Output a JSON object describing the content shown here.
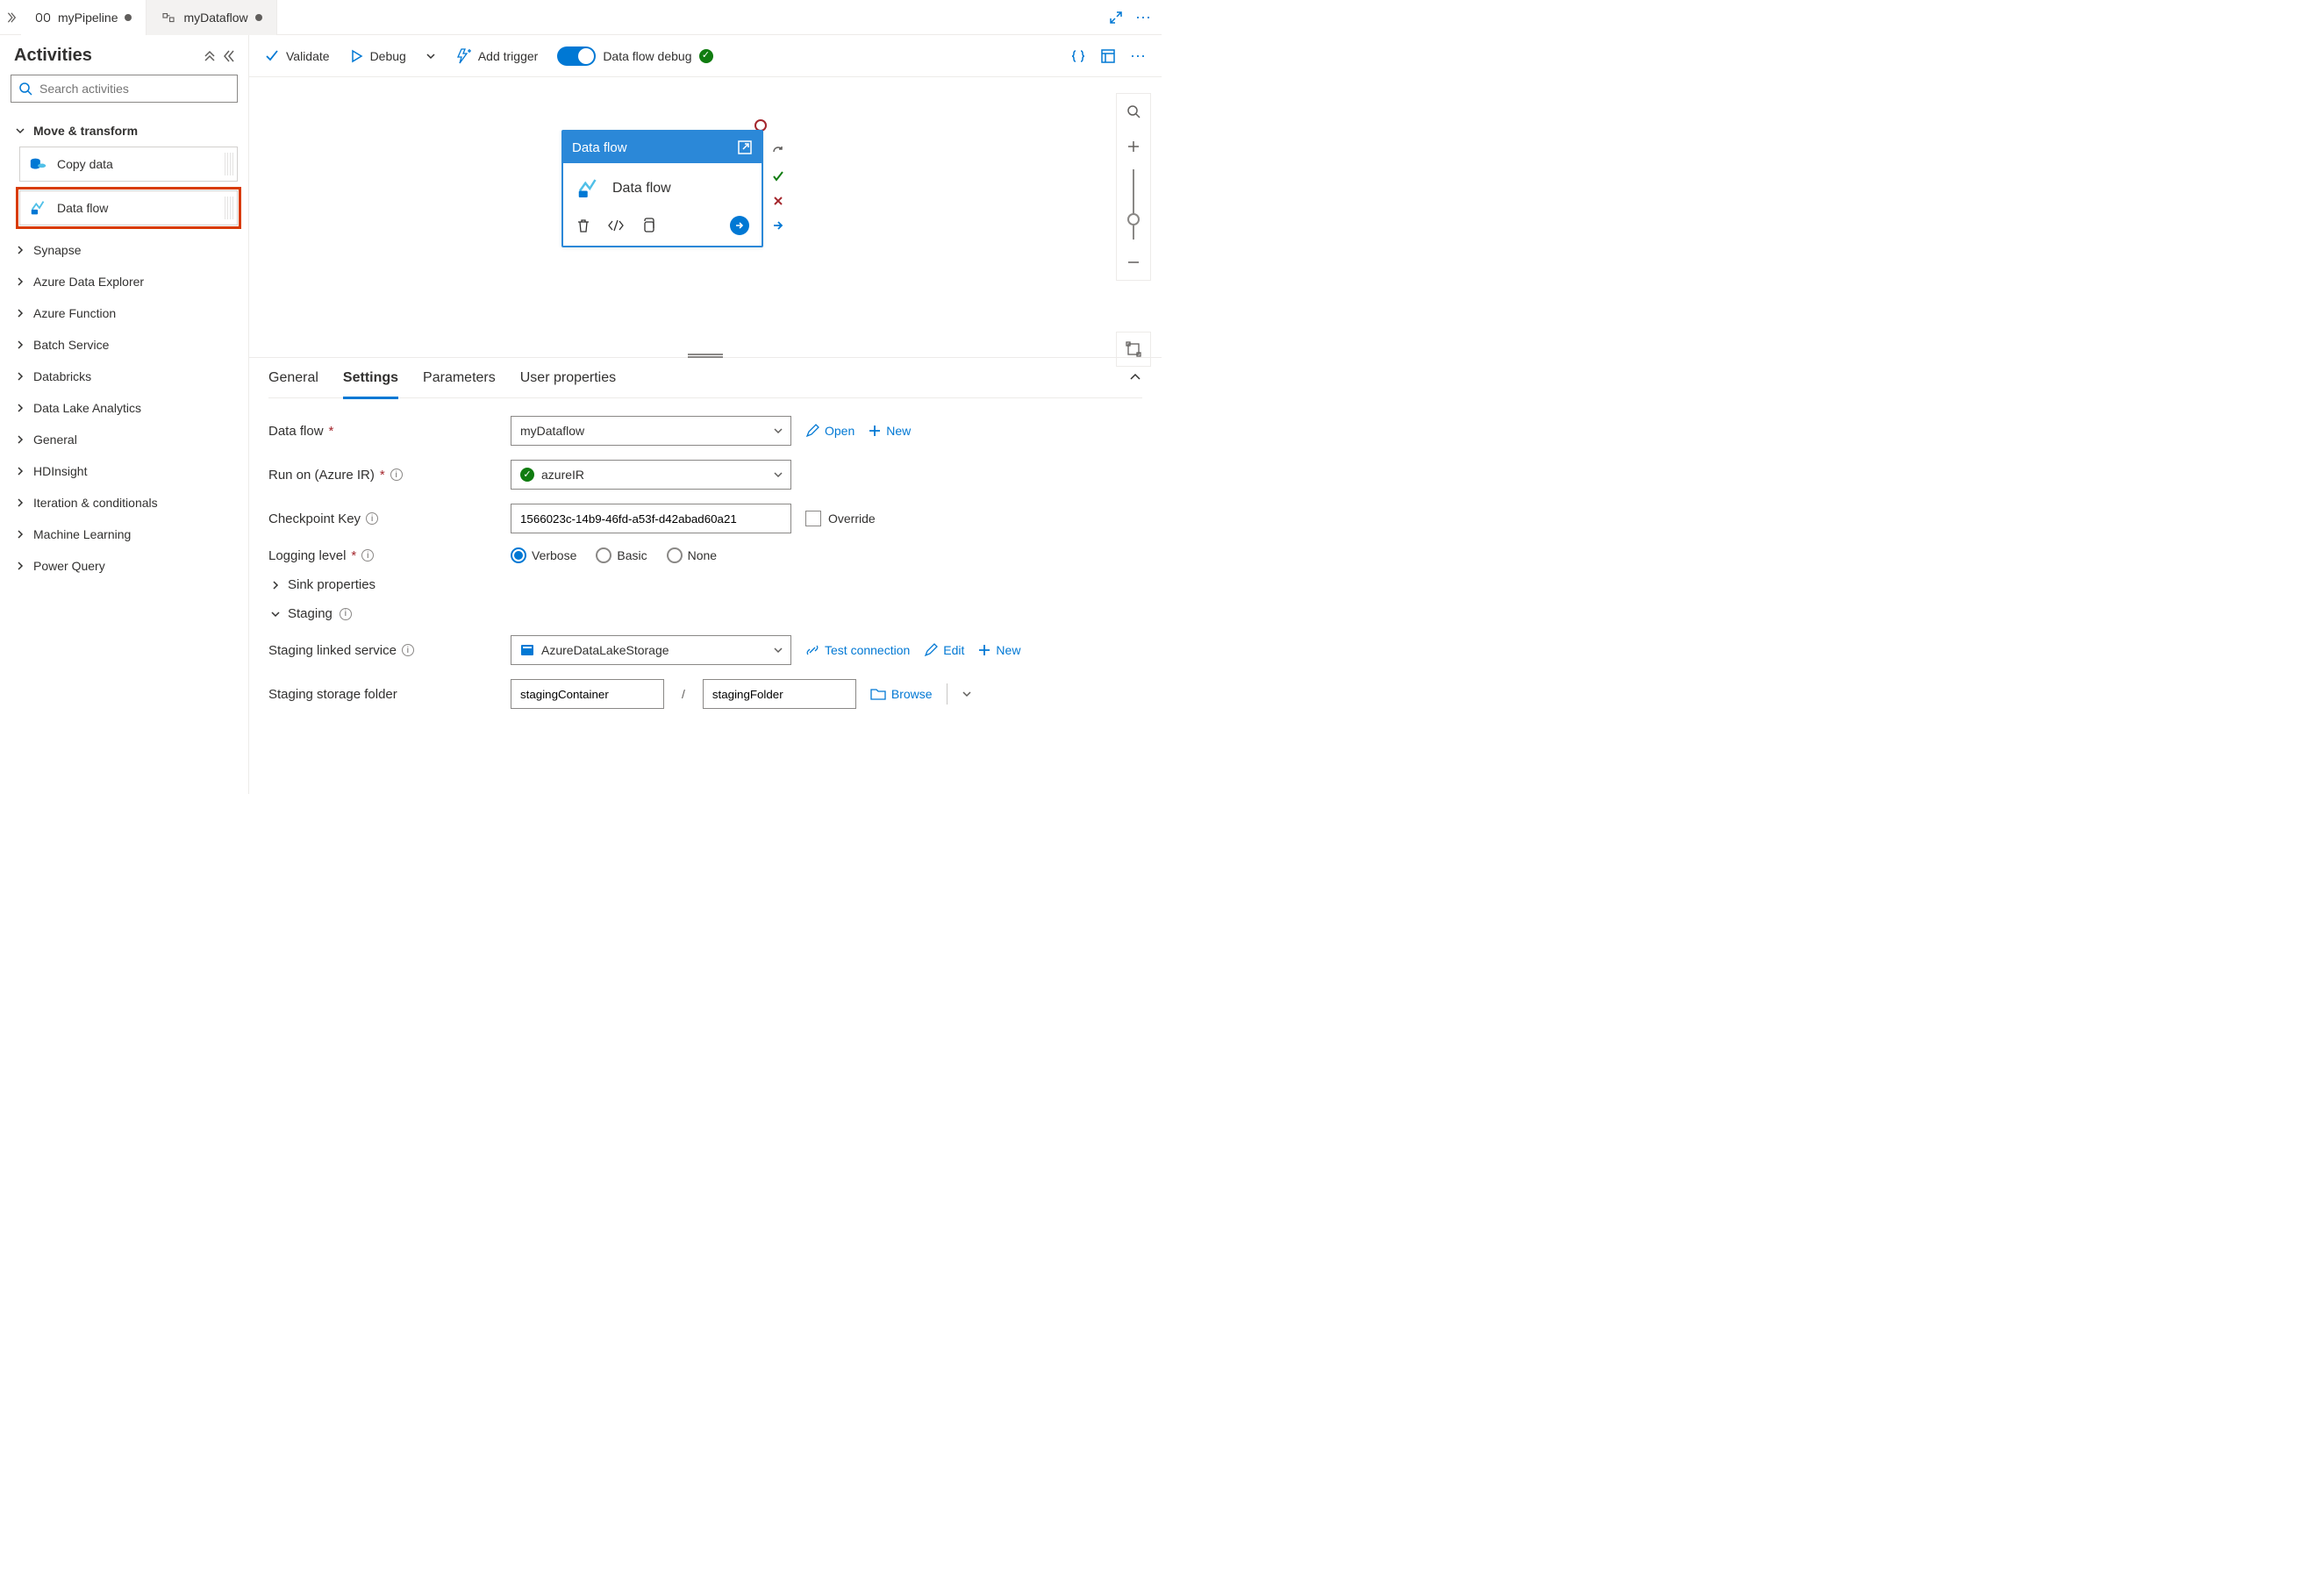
{
  "tabs": [
    {
      "label": "myPipeline",
      "dirty": true,
      "active": true
    },
    {
      "label": "myDataflow",
      "dirty": true,
      "active": false
    }
  ],
  "sidebar": {
    "title": "Activities",
    "search_placeholder": "Search activities",
    "mt_group": "Move & transform",
    "activities": [
      {
        "label": "Copy data"
      },
      {
        "label": "Data flow"
      }
    ],
    "groups": [
      "Synapse",
      "Azure Data Explorer",
      "Azure Function",
      "Batch Service",
      "Databricks",
      "Data Lake Analytics",
      "General",
      "HDInsight",
      "Iteration & conditionals",
      "Machine Learning",
      "Power Query"
    ]
  },
  "toolbar": {
    "validate": "Validate",
    "debug": "Debug",
    "add_trigger": "Add trigger",
    "df_debug": "Data flow debug"
  },
  "node": {
    "header": "Data flow",
    "title": "Data flow"
  },
  "props": {
    "tabs": [
      "General",
      "Settings",
      "Parameters",
      "User properties"
    ],
    "active_tab": 1,
    "dataflow_label": "Data flow",
    "dataflow_value": "myDataflow",
    "open": "Open",
    "new": "New",
    "runon_label": "Run on (Azure IR)",
    "runon_value": "azureIR",
    "checkpoint_label": "Checkpoint Key",
    "checkpoint_value": "1566023c-14b9-46fd-a53f-d42abad60a21",
    "override": "Override",
    "logging_label": "Logging level",
    "log_options": [
      "Verbose",
      "Basic",
      "None"
    ],
    "sink_props": "Sink properties",
    "staging": "Staging",
    "staging_linked_label": "Staging linked service",
    "staging_linked_value": "AzureDataLakeStorage",
    "test_connection": "Test connection",
    "edit": "Edit",
    "staging_folder_label": "Staging storage folder",
    "staging_container": "stagingContainer",
    "staging_folder": "stagingFolder",
    "browse": "Browse"
  }
}
